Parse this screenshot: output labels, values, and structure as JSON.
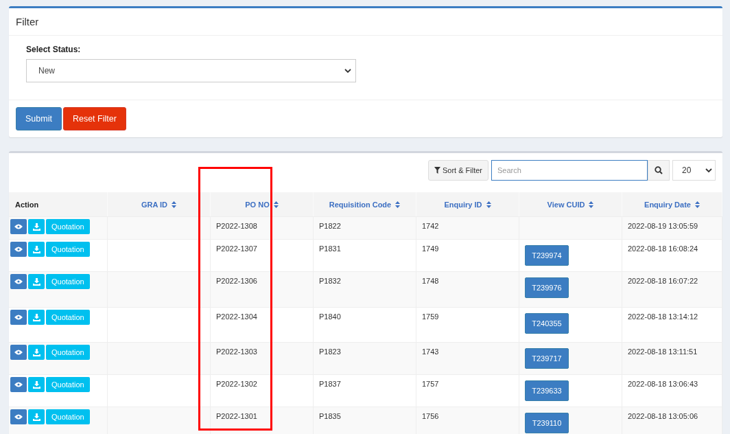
{
  "filter_panel": {
    "title": "Filter",
    "status_label": "Select Status:",
    "status_value": "New",
    "buttons": [
      {
        "label": "Submit",
        "kind": "primary"
      },
      {
        "label": "Reset Filter",
        "kind": "danger"
      }
    ]
  },
  "toolbar": {
    "sort_filter_label": "Sort & Filter",
    "search_placeholder": "Search",
    "page_size": "20"
  },
  "table": {
    "columns": [
      {
        "label": "Action",
        "sortable": false,
        "highlighted": false
      },
      {
        "label": "GRA ID",
        "sortable": true,
        "highlighted": false
      },
      {
        "label": "PO NO",
        "sortable": true,
        "highlighted": true
      },
      {
        "label": "Requisition Code",
        "sortable": true,
        "highlighted": false
      },
      {
        "label": "Enquiry ID",
        "sortable": true,
        "highlighted": false
      },
      {
        "label": "View CUID",
        "sortable": true,
        "highlighted": false
      },
      {
        "label": "Enquiry Date",
        "sortable": true,
        "highlighted": false
      }
    ],
    "rows": [
      {
        "action_label": "Quotation",
        "gra_id": "",
        "po_no": "P2022-1308",
        "requisition_code": "P1822",
        "enquiry_id": "1742",
        "cuid": "",
        "enquiry_date": "2022-08-19 13:05:59"
      },
      {
        "action_label": "Quotation",
        "gra_id": "",
        "po_no": "P2022-1307",
        "requisition_code": "P1831",
        "enquiry_id": "1749",
        "cuid": "T239974",
        "enquiry_date": "2022-08-18 16:08:24"
      },
      {
        "action_label": "Quotation",
        "gra_id": "",
        "po_no": "P2022-1306",
        "requisition_code": "P1832",
        "enquiry_id": "1748",
        "cuid": "T239976",
        "enquiry_date": "2022-08-18 16:07:22"
      },
      {
        "action_label": "Quotation",
        "gra_id": "",
        "po_no": "P2022-1304",
        "requisition_code": "P1840",
        "enquiry_id": "1759",
        "cuid": "T240355",
        "enquiry_date": "2022-08-18 13:14:12"
      },
      {
        "action_label": "Quotation",
        "gra_id": "",
        "po_no": "P2022-1303",
        "requisition_code": "P1823",
        "enquiry_id": "1743",
        "cuid": "T239717",
        "enquiry_date": "2022-08-18 13:11:51"
      },
      {
        "action_label": "Quotation",
        "gra_id": "",
        "po_no": "P2022-1302",
        "requisition_code": "P1837",
        "enquiry_id": "1757",
        "cuid": "T239633",
        "enquiry_date": "2022-08-18 13:06:43"
      },
      {
        "action_label": "Quotation",
        "gra_id": "",
        "po_no": "P2022-1301",
        "requisition_code": "P1835",
        "enquiry_id": "1756",
        "cuid": "T239110",
        "enquiry_date": "2022-08-18 13:05:06"
      }
    ]
  }
}
